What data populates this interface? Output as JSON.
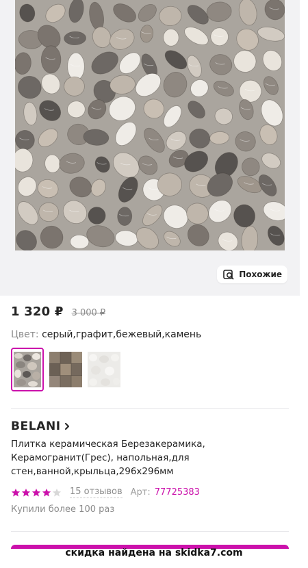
{
  "gallery": {
    "image_alt": "Pebble stone ceramic tile",
    "similar_label": "Похожие",
    "similar_icon": "search-image-icon"
  },
  "price": {
    "current": "1 320 ₽",
    "old": "3 000 ₽"
  },
  "color": {
    "label": "Цвет:",
    "value": "серый,графит,бежевый,камень"
  },
  "swatches": [
    {
      "name": "pebble",
      "active": true
    },
    {
      "name": "mosaic",
      "active": false
    },
    {
      "name": "light",
      "active": false
    }
  ],
  "product": {
    "brand": "BELANI",
    "title": "Плитка керамическая Березакерамика, Керамогранит(Грес), напольная,для стен,ванной,крыльца,296x296мм",
    "rating": 4,
    "rating_max": 5,
    "reviews": "15 отзывов",
    "article_label": "Арт:",
    "article_value": "77725383",
    "bought": "Купили более 100 раз"
  },
  "banner": {
    "text": "скидка найдена на skidka7.com"
  },
  "colors": {
    "accent": "#cb11ab",
    "star_filled": "#cb11ab",
    "star_empty": "#d8d8d8",
    "muted": "#8b8b8b"
  }
}
